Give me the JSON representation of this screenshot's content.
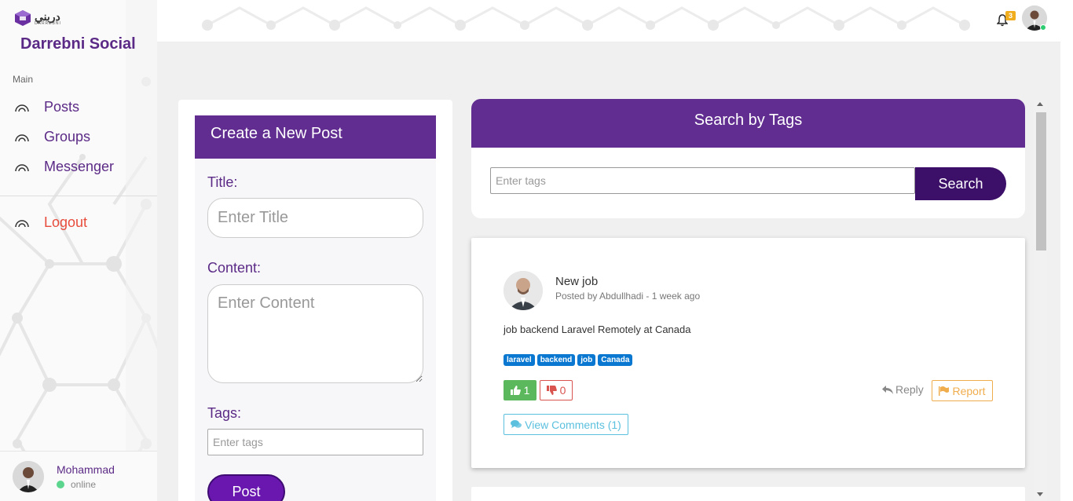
{
  "app": {
    "logo_arabic": "دربني",
    "logo_english": "DARREBNI",
    "brand": "Darrebni Social",
    "accent_color": "#612d91"
  },
  "sidebar": {
    "section_label": "Main",
    "items": [
      {
        "label": "Posts",
        "icon": "wifi-arc-icon"
      },
      {
        "label": "Groups",
        "icon": "wifi-arc-icon"
      },
      {
        "label": "Messenger",
        "icon": "wifi-arc-icon"
      }
    ],
    "logout_label": "Logout",
    "user": {
      "name": "Mohammad",
      "status": "online"
    }
  },
  "topbar": {
    "notification_count": "3"
  },
  "create_post": {
    "header": "Create a New Post",
    "title_label": "Title:",
    "title_placeholder": "Enter Title",
    "content_label": "Content:",
    "content_placeholder": "Enter Content",
    "tags_label": "Tags:",
    "tags_placeholder": "Enter tags",
    "submit_label": "Post"
  },
  "search": {
    "header": "Search by Tags",
    "placeholder": "Enter tags",
    "button_label": "Search"
  },
  "post": {
    "title": "New job",
    "meta": "Posted by Abdullhadi - 1 week ago",
    "content": "job backend Laravel Remotely at Canada",
    "tags": [
      "laravel",
      "backend",
      "job",
      "Canada"
    ],
    "likes": "1",
    "dislikes": "0",
    "reply_label": "Reply",
    "report_label": "Report",
    "comments_label": "View Comments (1)"
  }
}
